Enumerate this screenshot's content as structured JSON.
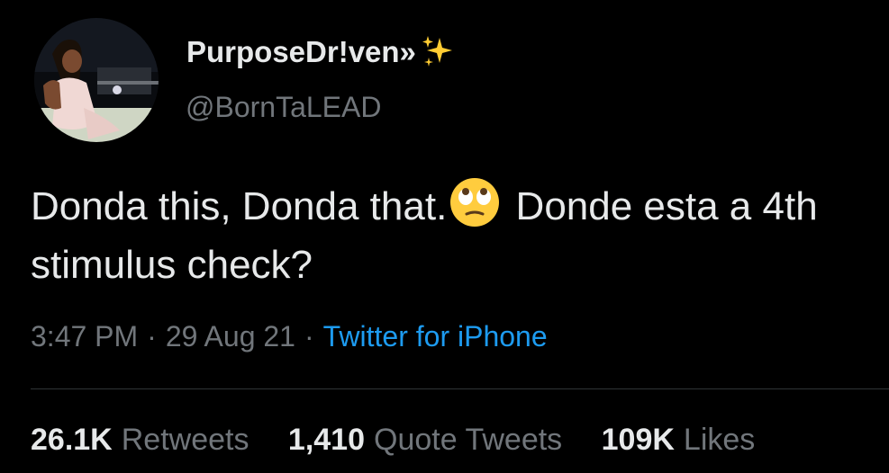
{
  "author": {
    "display_name": "PurposeDr!ven»",
    "name_emoji": "sparkles-icon",
    "handle": "@BornTaLEAD"
  },
  "tweet": {
    "text_part1": "Donda this, Donda that.",
    "text_emoji": "face-with-rolling-eyes-icon",
    "text_part2": " Donde esta a 4th stimulus check?"
  },
  "meta": {
    "time": "3:47 PM",
    "date": "29 Aug 21",
    "source": "Twitter for iPhone",
    "separator": "·"
  },
  "stats": {
    "retweets_count": "26.1K",
    "retweets_label": "Retweets",
    "quotes_count": "1,410",
    "quotes_label": "Quote Tweets",
    "likes_count": "109K",
    "likes_label": "Likes"
  },
  "colors": {
    "background": "#000000",
    "text_primary": "#e7e9ea",
    "text_secondary": "#71767b",
    "accent": "#1d9bf0",
    "divider": "#2f3336"
  }
}
